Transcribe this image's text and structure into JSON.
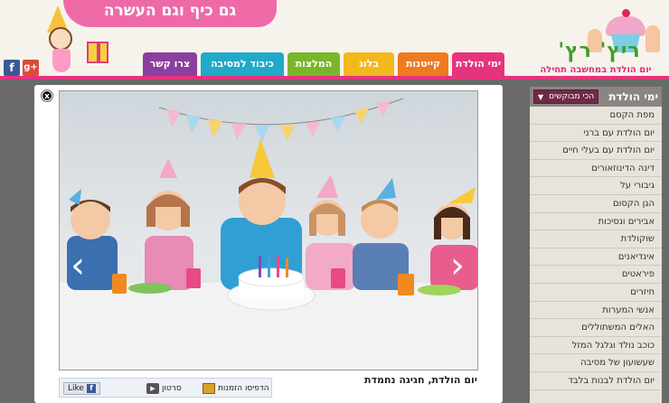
{
  "header": {
    "banner_text": "גם כיף וגם העשרה",
    "logo_name": "ריץ' רץ'",
    "logo_tagline": "יום הולדת במחשבה תחילה",
    "social": {
      "facebook": "f",
      "google_plus": "g+"
    }
  },
  "nav": {
    "tabs": [
      {
        "label": "ימי הולדת",
        "color": "#e6337e"
      },
      {
        "label": "קייטנות",
        "color": "#f07a1f"
      },
      {
        "label": "בלוג",
        "color": "#f2b81c"
      },
      {
        "label": "המלצות",
        "color": "#79b62a"
      },
      {
        "label": "כיבוד למסיבה",
        "color": "#20a9c9"
      },
      {
        "label": "צרו קשר",
        "color": "#8b3f9e"
      }
    ]
  },
  "sidebar": {
    "title": "ימי הולדת",
    "dropdown_value": "הכי מבוקשים",
    "items": [
      "מפת הקסם",
      "יום הולדת עם ברני",
      "יום הולדת עם בעלי חיים",
      "דינה הדינוזאורים",
      "גיבורי על",
      "הגן הקסום",
      "אבירים ונסיכות",
      "שוקולדת",
      "אינדיאנים",
      "פיראטים",
      "חיזרים",
      "אנשי המערות",
      "האלים המשתוללים",
      "כוכב נולד וגלגל המזל",
      "שעשועון של מסיבה",
      "יום הולדת לבנות בלבד"
    ]
  },
  "modal": {
    "close_label": "x",
    "prev_arrow": "‹",
    "next_arrow": "›",
    "caption": "יום הולדת, חגיגה נחמדת",
    "share": {
      "like": "Like",
      "video": "סרטון",
      "print": "הדפיסו הזמנות"
    }
  }
}
